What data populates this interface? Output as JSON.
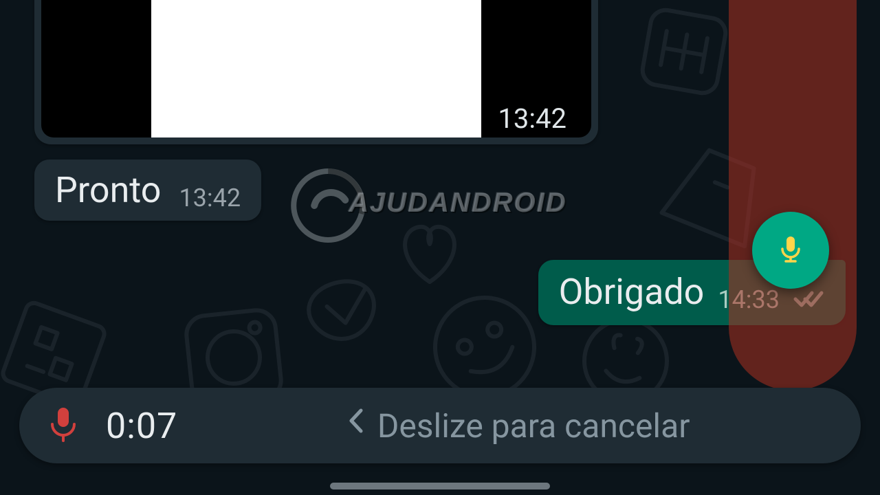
{
  "messages": {
    "incoming_image": {
      "time": "13:42"
    },
    "incoming_text": {
      "text": "Pronto",
      "time": "13:42"
    },
    "outgoing_text": {
      "text": "Obrigado",
      "time": "14:33",
      "status": "read"
    }
  },
  "recording": {
    "timer": "0:07",
    "slide_to_cancel": "Deslize para cancelar"
  },
  "watermark": {
    "text": "AJUDANDROID"
  },
  "colors": {
    "bg": "#0b141a",
    "bubble_in": "#1f2c34",
    "bubble_out": "#005c4b",
    "accent": "#00a884",
    "recording_mic": "#d1403d",
    "lock_overlay": "rgba(172,47,32,0.55)"
  }
}
